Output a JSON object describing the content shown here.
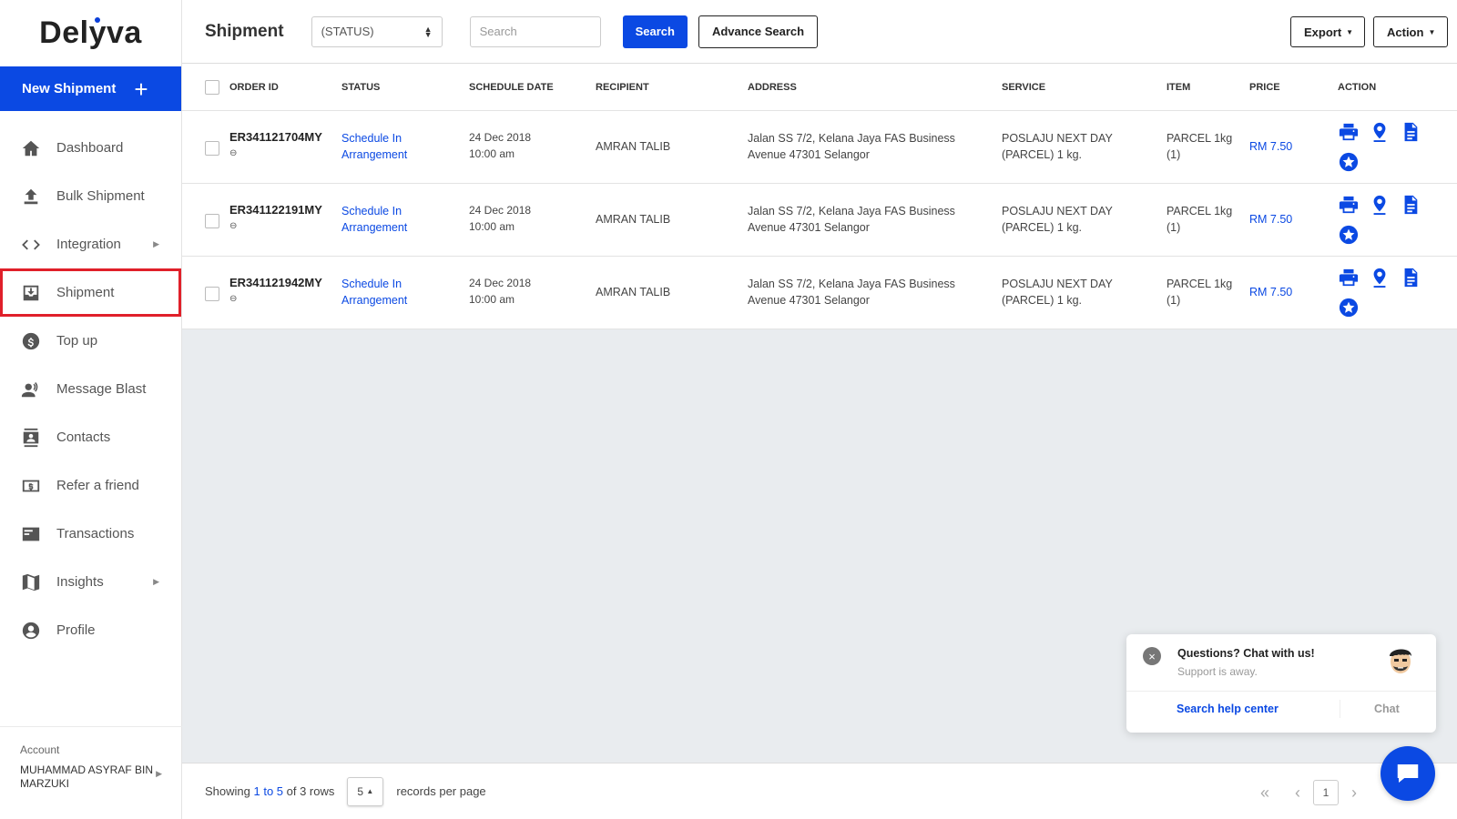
{
  "brand": {
    "logo_text_left": "Del",
    "logo_text_mid": "y",
    "logo_text_right": "va"
  },
  "sidebar": {
    "new_shipment_label": "New Shipment",
    "items": [
      {
        "label": "Dashboard",
        "icon": "home-icon",
        "has_submenu": false
      },
      {
        "label": "Bulk Shipment",
        "icon": "upload-icon",
        "has_submenu": false
      },
      {
        "label": "Integration",
        "icon": "code-icon",
        "has_submenu": true
      },
      {
        "label": "Shipment",
        "icon": "inbox-download-icon",
        "has_submenu": false,
        "active": true
      },
      {
        "label": "Top up",
        "icon": "dollar-icon",
        "has_submenu": false
      },
      {
        "label": "Message Blast",
        "icon": "broadcast-user-icon",
        "has_submenu": false
      },
      {
        "label": "Contacts",
        "icon": "contact-card-icon",
        "has_submenu": false
      },
      {
        "label": "Refer a friend",
        "icon": "money-bill-icon",
        "has_submenu": false
      },
      {
        "label": "Transactions",
        "icon": "credit-card-icon",
        "has_submenu": false
      },
      {
        "label": "Insights",
        "icon": "map-icon",
        "has_submenu": true
      },
      {
        "label": "Profile",
        "icon": "user-circle-icon",
        "has_submenu": false
      }
    ],
    "account": {
      "label": "Account",
      "name": "MUHAMMAD ASYRAF BIN MARZUKI"
    }
  },
  "header": {
    "title": "Shipment",
    "status_select": "(STATUS)",
    "search_placeholder": "Search",
    "search_button": "Search",
    "advance_search_button": "Advance Search",
    "export_button": "Export",
    "action_button": "Action"
  },
  "table": {
    "columns": [
      "ORDER ID",
      "STATUS",
      "SCHEDULE DATE",
      "RECIPIENT",
      "ADDRESS",
      "SERVICE",
      "ITEM",
      "PRICE",
      "ACTION"
    ],
    "rows": [
      {
        "order_id": "ER341121704MY",
        "status_line1": "Schedule In",
        "status_line2": "Arrangement",
        "date": "24 Dec 2018",
        "time": "10:00 am",
        "recipient": "AMRAN TALIB",
        "address_line1": "Jalan SS 7/2, Kelana Jaya FAS Business",
        "address_line2": "Avenue 47301 Selangor",
        "service_line1": "POSLAJU NEXT DAY",
        "service_line2": "(PARCEL) 1 kg.",
        "item_line1": "PARCEL 1kg",
        "item_line2": "(1)",
        "price": "RM 7.50"
      },
      {
        "order_id": "ER341122191MY",
        "status_line1": "Schedule In",
        "status_line2": "Arrangement",
        "date": "24 Dec 2018",
        "time": "10:00 am",
        "recipient": "AMRAN TALIB",
        "address_line1": "Jalan SS 7/2, Kelana Jaya FAS Business",
        "address_line2": "Avenue 47301 Selangor",
        "service_line1": "POSLAJU NEXT DAY",
        "service_line2": "(PARCEL) 1 kg.",
        "item_line1": "PARCEL 1kg",
        "item_line2": "(1)",
        "price": "RM 7.50"
      },
      {
        "order_id": "ER341121942MY",
        "status_line1": "Schedule In",
        "status_line2": "Arrangement",
        "date": "24 Dec 2018",
        "time": "10:00 am",
        "recipient": "AMRAN TALIB",
        "address_line1": "Jalan SS 7/2, Kelana Jaya FAS Business",
        "address_line2": "Avenue 47301 Selangor",
        "service_line1": "POSLAJU NEXT DAY",
        "service_line2": "(PARCEL) 1 kg.",
        "item_line1": "PARCEL 1kg",
        "item_line2": "(1)",
        "price": "RM 7.50"
      }
    ]
  },
  "footer": {
    "showing_prefix": "Showing ",
    "showing_range": "1 to 5",
    "showing_suffix": " of 3 rows",
    "per_page_value": "5",
    "records_per_page": "records per page",
    "current_page": "1"
  },
  "chat": {
    "title": "Questions? Chat with us!",
    "subtitle": "Support is away.",
    "help_link": "Search help center",
    "chat_button": "Chat"
  },
  "colors": {
    "brand_blue": "#0b49e3",
    "active_outline": "#e0202a"
  }
}
